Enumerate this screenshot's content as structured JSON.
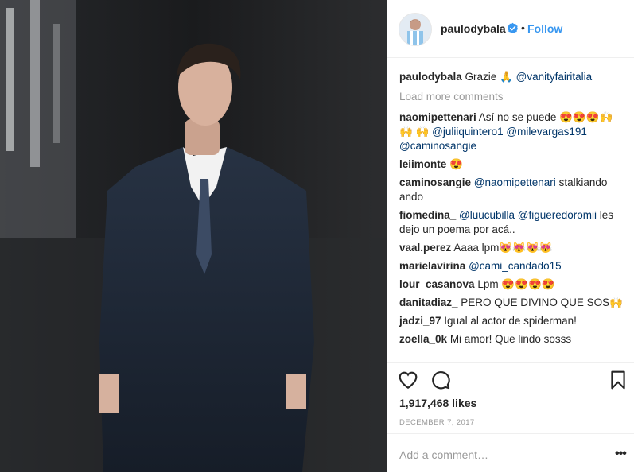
{
  "post": {
    "author": "paulodybala",
    "separator": "•",
    "follow_label": "Follow",
    "caption": {
      "user": "paulodybala",
      "text": "Grazie 🙏 ",
      "mention": "@vanityfairitalia"
    },
    "load_more_label": "Load more comments",
    "comments": [
      {
        "user": "naomipettenari",
        "segments": [
          {
            "t": "Así no se puede 😍😍😍🙌🙌 🙌 "
          },
          {
            "t": "@juliiquintero1",
            "m": true
          },
          {
            "t": " "
          },
          {
            "t": "@milevargas191",
            "m": true
          },
          {
            "t": " "
          },
          {
            "t": "@caminosangie",
            "m": true
          }
        ]
      },
      {
        "user": "leiimonte",
        "segments": [
          {
            "t": "😍"
          }
        ]
      },
      {
        "user": "caminosangie",
        "segments": [
          {
            "t": "@naomipettenari",
            "m": true
          },
          {
            "t": " stalkiando ando"
          }
        ]
      },
      {
        "user": "fiomedina_",
        "segments": [
          {
            "t": "@luucubilla",
            "m": true
          },
          {
            "t": " "
          },
          {
            "t": "@figueredoromii",
            "m": true
          },
          {
            "t": " les dejo un poema por acá.."
          }
        ]
      },
      {
        "user": "vaal.perez",
        "segments": [
          {
            "t": "Aaaa lpm😻😻😻😻"
          }
        ]
      },
      {
        "user": "marielavirina",
        "segments": [
          {
            "t": "@cami_candado15",
            "m": true
          }
        ]
      },
      {
        "user": "lour_casanova",
        "segments": [
          {
            "t": "Lpm 😍😍😍😍"
          }
        ]
      },
      {
        "user": "danitadiaz_",
        "segments": [
          {
            "t": "PERO QUE DIVINO QUE SOS🙌"
          }
        ]
      },
      {
        "user": "jadzi_97",
        "segments": [
          {
            "t": "Igual al actor de spiderman!"
          }
        ]
      },
      {
        "user": "zoella_0k",
        "segments": [
          {
            "t": "Mi amor! Que lindo sosss"
          }
        ]
      }
    ],
    "likes": "1,917,468 likes",
    "date": "DECEMBER 7, 2017",
    "add_comment_placeholder": "Add a comment…",
    "more_label": "•••"
  },
  "icons": {
    "like": "heart-icon",
    "comment": "comment-bubble-icon",
    "save": "bookmark-icon",
    "verified": "verified-badge-icon"
  },
  "colors": {
    "accent": "#3897f0",
    "mention": "#003569",
    "muted": "#999999",
    "text": "#262626"
  }
}
